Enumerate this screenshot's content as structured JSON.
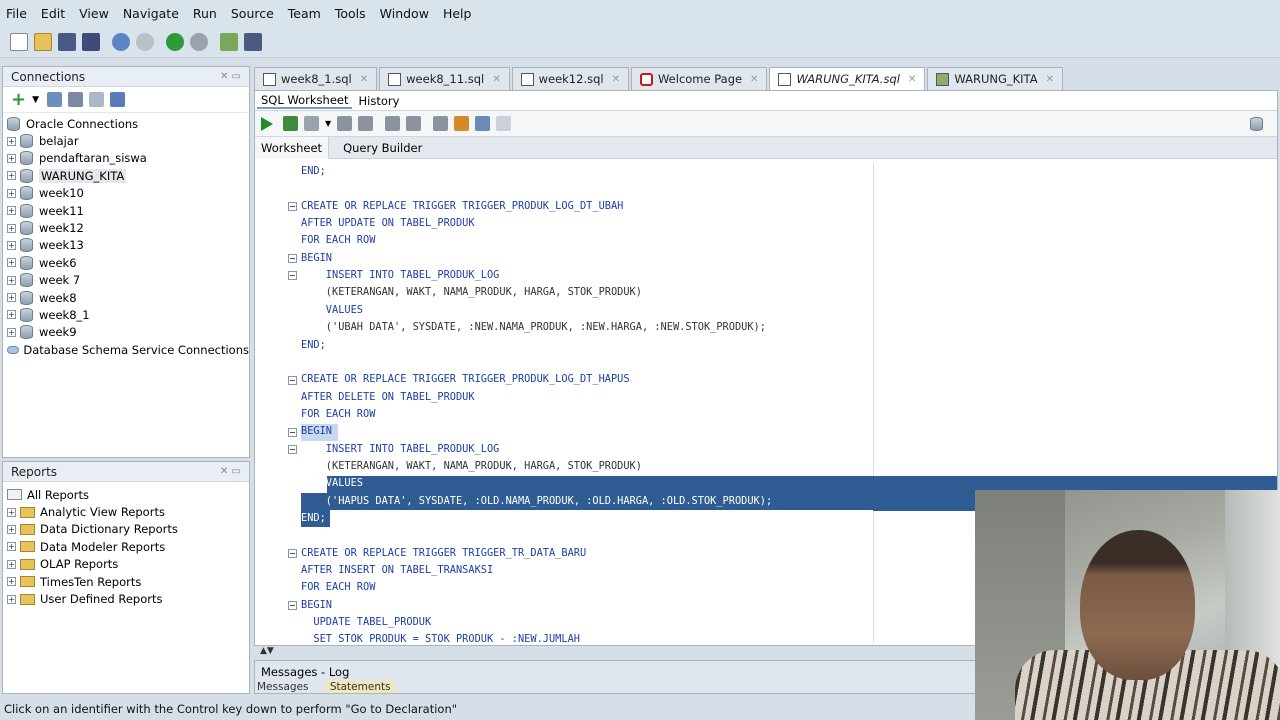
{
  "menu": [
    "File",
    "Edit",
    "View",
    "Navigate",
    "Run",
    "Source",
    "Team",
    "Tools",
    "Window",
    "Help"
  ],
  "connections": {
    "title": "Connections",
    "root": "Oracle Connections",
    "items": [
      "belajar",
      "pendaftaran_siswa",
      "WARUNG_KITA",
      "week10",
      "week11",
      "week12",
      "week13",
      "week6",
      "week 7",
      "week8",
      "week8_1",
      "week9"
    ],
    "footer": "Database Schema Service Connections"
  },
  "reports": {
    "title": "Reports",
    "root": "All Reports",
    "items": [
      "Analytic View Reports",
      "Data Dictionary Reports",
      "Data Modeler Reports",
      "OLAP Reports",
      "TimesTen Reports",
      "User Defined Reports"
    ]
  },
  "tabs": [
    "week8_1.sql",
    "week8_11.sql",
    "week12.sql",
    "Welcome Page",
    "WARUNG_KITA.sql",
    "WARUNG_KITA"
  ],
  "subtabs": [
    "SQL Worksheet",
    "History"
  ],
  "query_tabs": [
    "Worksheet",
    "Query Builder"
  ],
  "code": [
    "END;",
    "",
    "CREATE OR REPLACE TRIGGER TRIGGER_PRODUK_LOG_DT_UBAH",
    "AFTER UPDATE ON TABEL_PRODUK",
    "FOR EACH ROW",
    "BEGIN",
    "    INSERT INTO TABEL_PRODUK_LOG",
    "    (KETERANGAN, WAKT, NAMA_PRODUK, HARGA, STOK_PRODUK)",
    "    VALUES",
    "    ('UBAH DATA', SYSDATE, :NEW.NAMA_PRODUK, :NEW.HARGA, :NEW.STOK_PRODUK);",
    "END;",
    "",
    "CREATE OR REPLACE TRIGGER TRIGGER_PRODUK_LOG_DT_HAPUS",
    "AFTER DELETE ON TABEL_PRODUK",
    "FOR EACH ROW",
    "BEGIN",
    "    INSERT INTO TABEL_PRODUK_LOG",
    "    (KETERANGAN, WAKT, NAMA_PRODUK, HARGA, STOK_PRODUK)",
    "    VALUES",
    "    ('HAPUS DATA', SYSDATE, :OLD.NAMA_PRODUK, :OLD.HARGA, :OLD.STOK_PRODUK);",
    "END;",
    "",
    "CREATE OR REPLACE TRIGGER TRIGGER_TR_DATA_BARU",
    "AFTER INSERT ON TABEL_TRANSAKSI",
    "FOR EACH ROW",
    "BEGIN",
    "  UPDATE TABEL_PRODUK",
    "  SET STOK_PRODUK = STOK_PRODUK - :NEW.JUMLAH"
  ],
  "messages": {
    "title": "Messages - Log",
    "tabs": [
      "Messages",
      "Statements"
    ]
  },
  "status": "Click on an identifier with the Control key down to perform \"Go to Declaration\""
}
